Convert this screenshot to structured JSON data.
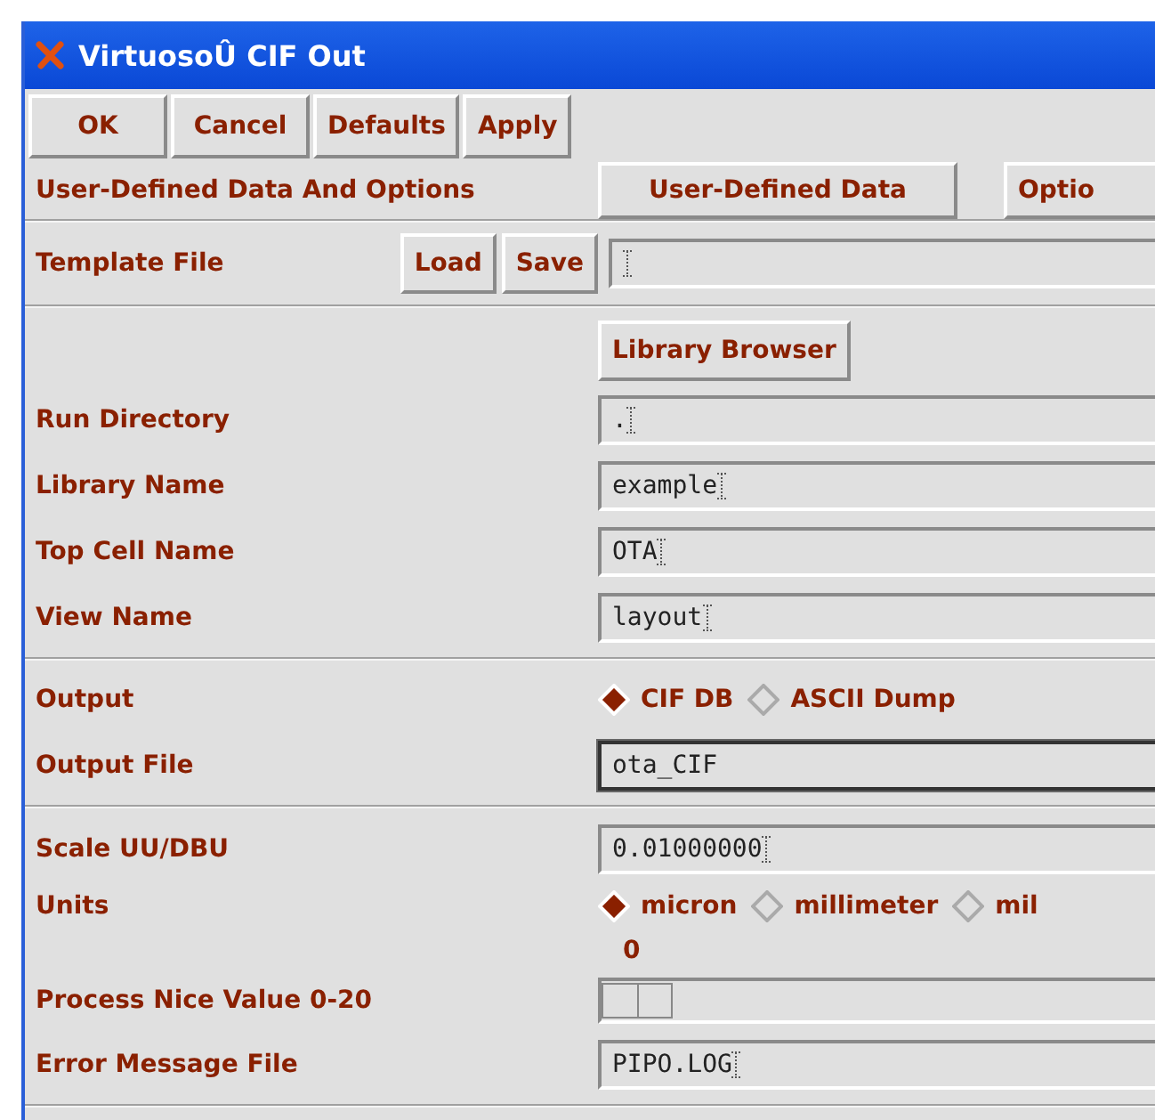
{
  "window": {
    "title": "VirtuosoÛ CIF Out"
  },
  "buttons": [
    "OK",
    "Cancel",
    "Defaults",
    "Apply"
  ],
  "options_bar": {
    "label": "User-Defined Data And Options",
    "buttons": [
      "User-Defined Data",
      "Optio"
    ]
  },
  "sections": [
    {
      "rows": [
        {
          "kind": "template",
          "label": "Template File",
          "buttons": [
            "Load",
            "Save"
          ],
          "field": {
            "caret": true,
            "focused": false
          }
        }
      ]
    },
    {
      "rows": [
        {
          "kind": "button",
          "button": "Library Browser"
        },
        {
          "kind": "field",
          "label": "Run Directory",
          "field": {
            "value": ".",
            "caret": true,
            "focused": false
          }
        },
        {
          "kind": "field",
          "label": "Library Name",
          "field": {
            "value": "example",
            "caret": true,
            "focused": false
          }
        },
        {
          "kind": "field",
          "label": "Top Cell Name",
          "field": {
            "value": "OTA",
            "caret": true,
            "focused": false
          }
        },
        {
          "kind": "field",
          "label": "View Name",
          "field": {
            "value": "layout",
            "caret": true,
            "focused": false
          }
        }
      ]
    },
    {
      "rows": [
        {
          "kind": "radio",
          "label": "Output",
          "options": [
            {
              "label": "CIF DB",
              "selected": true
            },
            {
              "label": "ASCII Dump",
              "selected": false
            }
          ]
        },
        {
          "kind": "field",
          "label": "Output File",
          "field": {
            "value": "ota_CIF",
            "focused": true
          }
        }
      ]
    },
    {
      "rows": [
        {
          "kind": "field",
          "label": "Scale UU/DBU",
          "field": {
            "value": "0.01000000",
            "caret": true,
            "focused": false
          }
        },
        {
          "kind": "radio",
          "label": "Units",
          "options": [
            {
              "label": "micron",
              "selected": true
            },
            {
              "label": "millimeter",
              "selected": false
            },
            {
              "label": "mil",
              "selected": false
            }
          ]
        },
        {
          "kind": "slider",
          "label": "Process Nice Value 0-20",
          "reading": "0",
          "level": 0
        },
        {
          "kind": "field",
          "label": "Error Message File",
          "field": {
            "value": "PIPO.LOG",
            "caret": true,
            "focused": false
          }
        }
      ]
    }
  ]
}
